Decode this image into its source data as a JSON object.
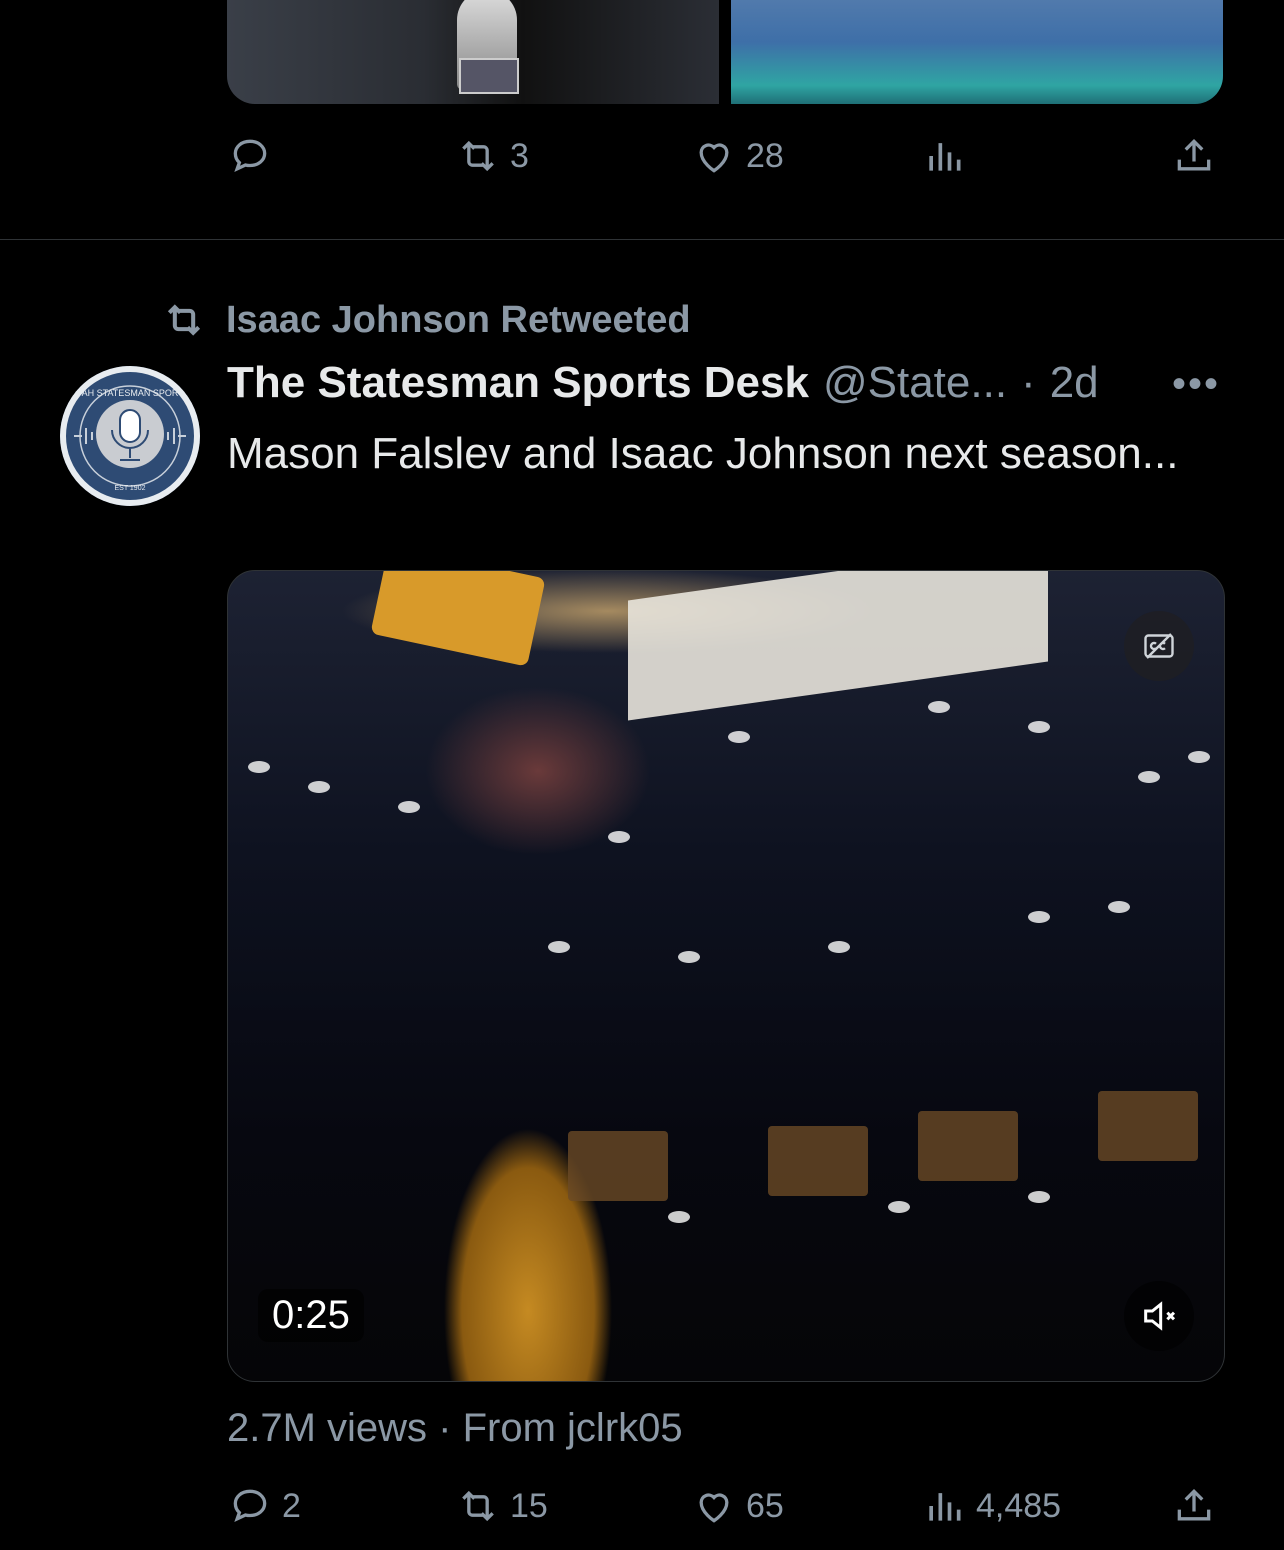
{
  "prev_tweet": {
    "actions": {
      "reply": "",
      "retweet": "3",
      "like": "28",
      "views": "",
      "share": ""
    }
  },
  "retweet_banner": {
    "text": "Isaac Johnson Retweeted"
  },
  "tweet": {
    "avatar_text": {
      "top": "UTAH STATESMAN SPORTS",
      "bottom": "EST 1902"
    },
    "display_name": "The Statesman Sports Desk",
    "handle": "@State...",
    "separator": "·",
    "time": "2d",
    "more": "•••",
    "text": "Mason Falslev and Isaac Johnson next season...",
    "video": {
      "duration": "0:25"
    },
    "meta": "2.7M views · From jclrk05",
    "actions": {
      "reply": "2",
      "retweet": "15",
      "like": "65",
      "views": "4,485",
      "share": ""
    }
  },
  "icons": [
    "reply-icon",
    "retweet-icon",
    "like-icon",
    "views-icon",
    "share-icon",
    "captions-icon",
    "mute-icon",
    "more-icon"
  ],
  "colors": {
    "background": "#000000",
    "muted": "#8b98a5",
    "text": "#e7e9ea",
    "divider": "#2f3336"
  }
}
